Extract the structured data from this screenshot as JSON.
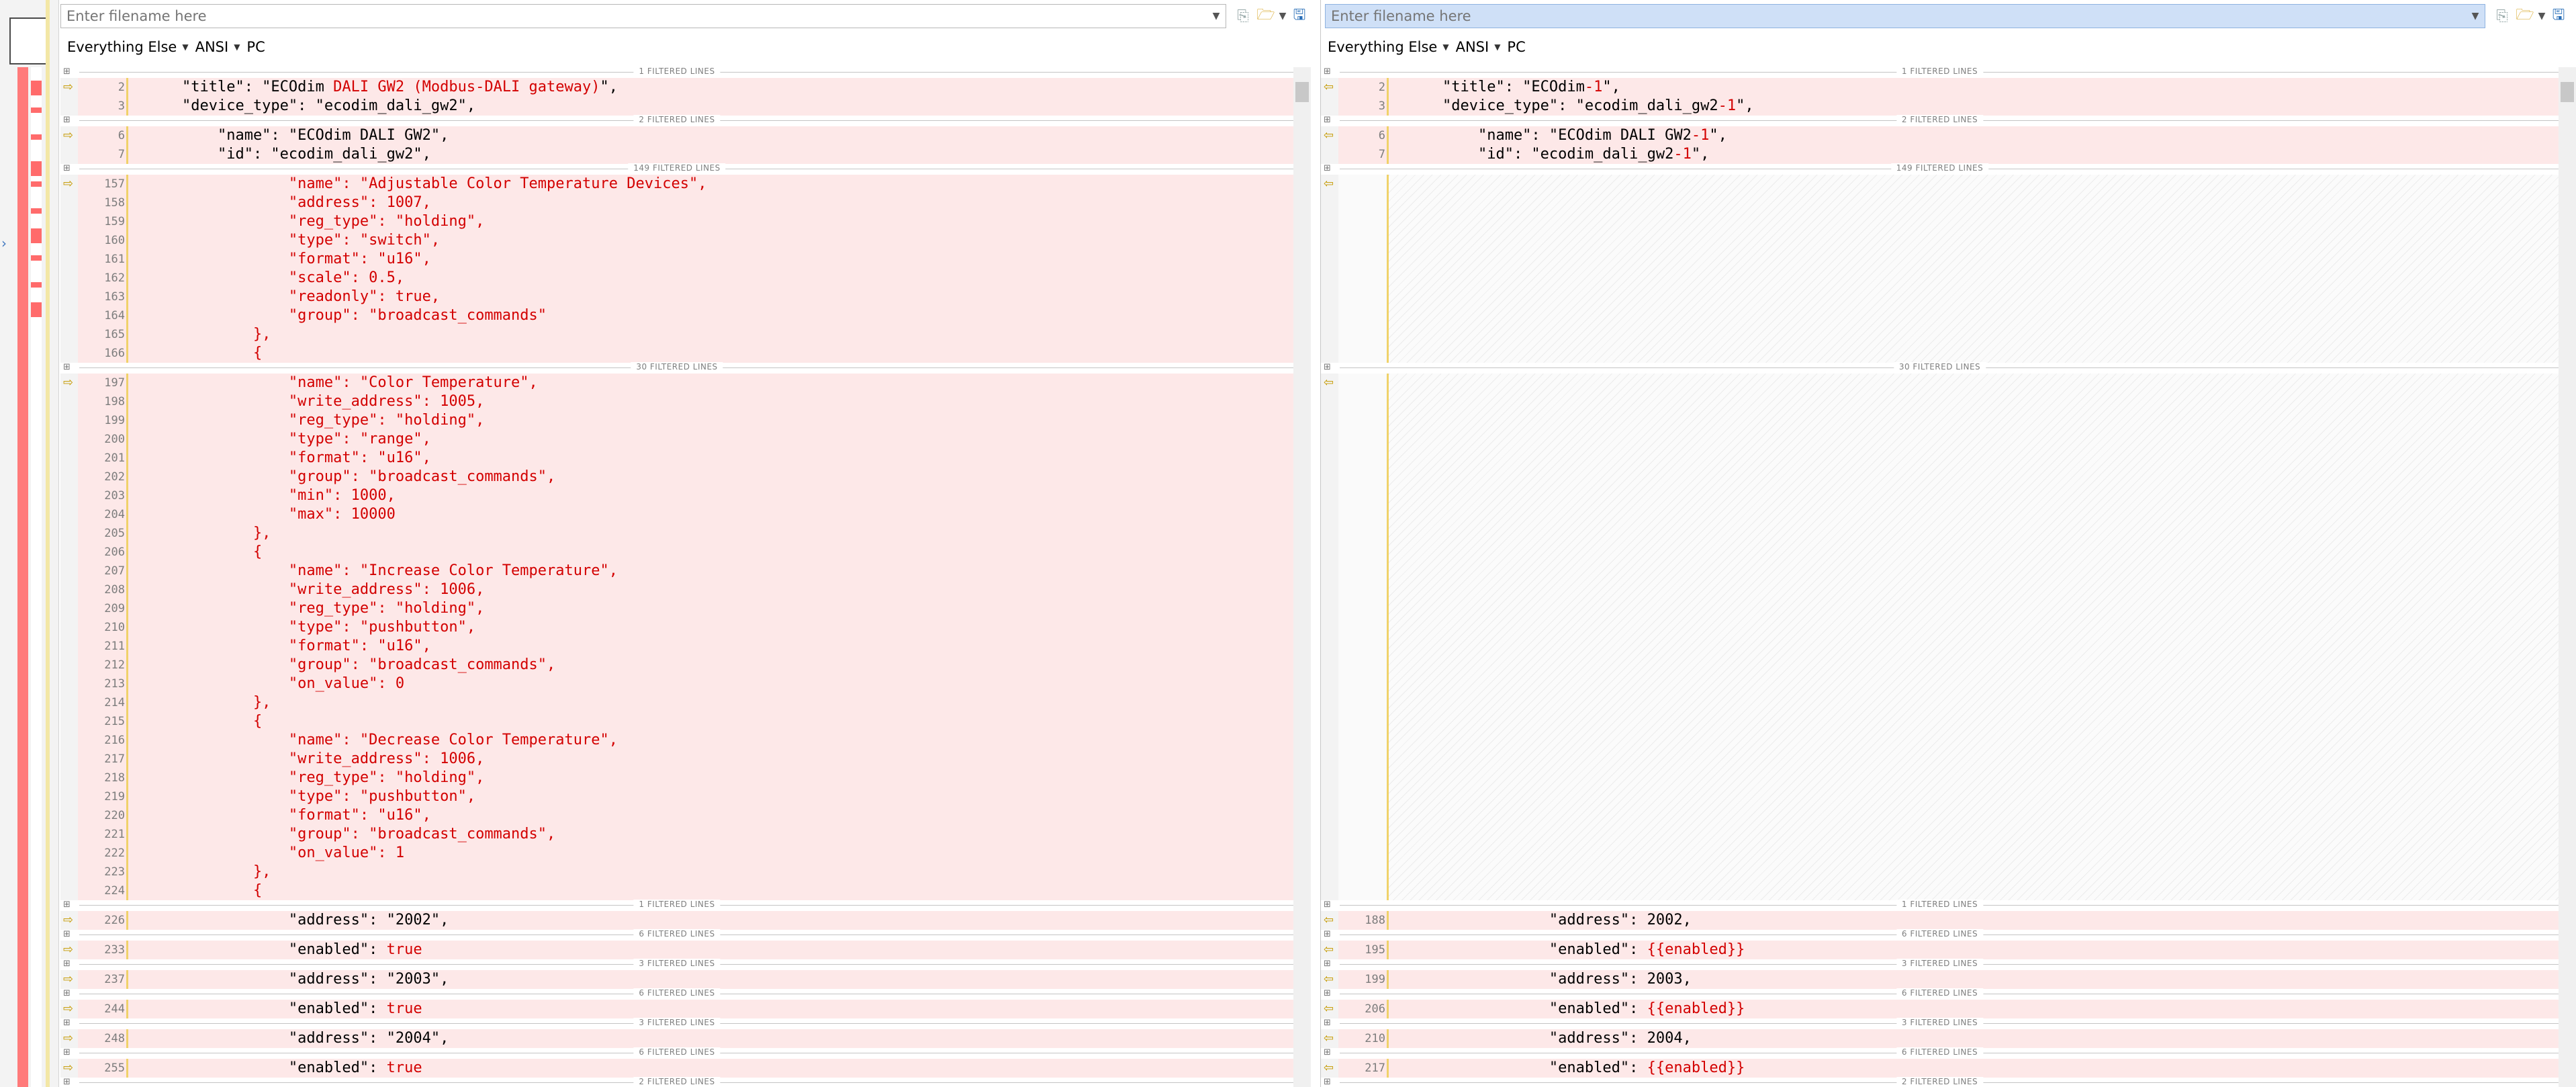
{
  "separator_label_suffix": "FILTERED LINES",
  "left": {
    "path_placeholder": "Enter filename here",
    "mode": {
      "filter": "Everything Else",
      "encoding": "ANSI",
      "line_endings": "PC"
    },
    "blocks": [
      {
        "kind": "sep",
        "count": "1 FILTERED LINES"
      },
      {
        "kind": "line",
        "num": "2",
        "text": "    \"title\": \"ECOdim ",
        "red": "DALI GW2 (Modbus-DALI gateway)",
        "tail": "\",",
        "arrow": true
      },
      {
        "kind": "line",
        "num": "3",
        "text": "    \"device_type\": \"ecodim_dali_gw2\","
      },
      {
        "kind": "sep",
        "count": "2 FILTERED LINES"
      },
      {
        "kind": "line",
        "num": "6",
        "text": "        \"name\": \"ECOdim DALI GW2\",",
        "arrow": true
      },
      {
        "kind": "line",
        "num": "7",
        "text": "        \"id\": \"ecodim_dali_gw2\","
      },
      {
        "kind": "sep",
        "count": "149 FILTERED LINES"
      },
      {
        "kind": "rline",
        "num": "157",
        "text": "                \"name\": \"Adjustable Color Temperature Devices\",",
        "arrow": true
      },
      {
        "kind": "rline",
        "num": "158",
        "text": "                \"address\": 1007,"
      },
      {
        "kind": "rline",
        "num": "159",
        "text": "                \"reg_type\": \"holding\","
      },
      {
        "kind": "rline",
        "num": "160",
        "text": "                \"type\": \"switch\","
      },
      {
        "kind": "rline",
        "num": "161",
        "text": "                \"format\": \"u16\","
      },
      {
        "kind": "rline",
        "num": "162",
        "text": "                \"scale\": 0.5,"
      },
      {
        "kind": "rline",
        "num": "163",
        "text": "                \"readonly\": true,"
      },
      {
        "kind": "rline",
        "num": "164",
        "text": "                \"group\": \"broadcast_commands\""
      },
      {
        "kind": "rline",
        "num": "165",
        "text": "            },"
      },
      {
        "kind": "rline",
        "num": "166",
        "text": "            {"
      },
      {
        "kind": "sep",
        "count": "30 FILTERED LINES"
      },
      {
        "kind": "rline",
        "num": "197",
        "text": "                \"name\": \"Color Temperature\",",
        "arrow": true
      },
      {
        "kind": "rline",
        "num": "198",
        "text": "                \"write_address\": 1005,"
      },
      {
        "kind": "rline",
        "num": "199",
        "text": "                \"reg_type\": \"holding\","
      },
      {
        "kind": "rline",
        "num": "200",
        "text": "                \"type\": \"range\","
      },
      {
        "kind": "rline",
        "num": "201",
        "text": "                \"format\": \"u16\","
      },
      {
        "kind": "rline",
        "num": "202",
        "text": "                \"group\": \"broadcast_commands\","
      },
      {
        "kind": "rline",
        "num": "203",
        "text": "                \"min\": 1000,"
      },
      {
        "kind": "rline",
        "num": "204",
        "text": "                \"max\": 10000"
      },
      {
        "kind": "rline",
        "num": "205",
        "text": "            },"
      },
      {
        "kind": "rline",
        "num": "206",
        "text": "            {"
      },
      {
        "kind": "rline",
        "num": "207",
        "text": "                \"name\": \"Increase Color Temperature\","
      },
      {
        "kind": "rline",
        "num": "208",
        "text": "                \"write_address\": 1006,"
      },
      {
        "kind": "rline",
        "num": "209",
        "text": "                \"reg_type\": \"holding\","
      },
      {
        "kind": "rline",
        "num": "210",
        "text": "                \"type\": \"pushbutton\","
      },
      {
        "kind": "rline",
        "num": "211",
        "text": "                \"format\": \"u16\","
      },
      {
        "kind": "rline",
        "num": "212",
        "text": "                \"group\": \"broadcast_commands\","
      },
      {
        "kind": "rline",
        "num": "213",
        "text": "                \"on_value\": 0"
      },
      {
        "kind": "rline",
        "num": "214",
        "text": "            },"
      },
      {
        "kind": "rline",
        "num": "215",
        "text": "            {"
      },
      {
        "kind": "rline",
        "num": "216",
        "text": "                \"name\": \"Decrease Color Temperature\","
      },
      {
        "kind": "rline",
        "num": "217",
        "text": "                \"write_address\": 1006,"
      },
      {
        "kind": "rline",
        "num": "218",
        "text": "                \"reg_type\": \"holding\","
      },
      {
        "kind": "rline",
        "num": "219",
        "text": "                \"type\": \"pushbutton\","
      },
      {
        "kind": "rline",
        "num": "220",
        "text": "                \"format\": \"u16\","
      },
      {
        "kind": "rline",
        "num": "221",
        "text": "                \"group\": \"broadcast_commands\","
      },
      {
        "kind": "rline",
        "num": "222",
        "text": "                \"on_value\": 1"
      },
      {
        "kind": "rline",
        "num": "223",
        "text": "            },"
      },
      {
        "kind": "rline",
        "num": "224",
        "text": "            {"
      },
      {
        "kind": "sep",
        "count": "1 FILTERED LINES"
      },
      {
        "kind": "line",
        "num": "226",
        "text": "                \"address\": \"2002\",",
        "arrow": true
      },
      {
        "kind": "sep",
        "count": "6 FILTERED LINES"
      },
      {
        "kind": "line",
        "num": "233",
        "text": "                \"enabled\": ",
        "red": "true",
        "tail": "",
        "arrow": true
      },
      {
        "kind": "sep",
        "count": "3 FILTERED LINES"
      },
      {
        "kind": "line",
        "num": "237",
        "text": "                \"address\": \"2003\",",
        "arrow": true
      },
      {
        "kind": "sep",
        "count": "6 FILTERED LINES"
      },
      {
        "kind": "line",
        "num": "244",
        "text": "                \"enabled\": ",
        "red": "true",
        "tail": "",
        "arrow": true
      },
      {
        "kind": "sep",
        "count": "3 FILTERED LINES"
      },
      {
        "kind": "line",
        "num": "248",
        "text": "                \"address\": \"2004\",",
        "arrow": true
      },
      {
        "kind": "sep",
        "count": "6 FILTERED LINES"
      },
      {
        "kind": "line",
        "num": "255",
        "text": "                \"enabled\": ",
        "red": "true",
        "tail": "",
        "arrow": true
      },
      {
        "kind": "sep",
        "count": "2 FILTERED LINES"
      }
    ]
  },
  "right": {
    "path_placeholder": "Enter filename here",
    "mode": {
      "filter": "Everything Else",
      "encoding": "ANSI",
      "line_endings": "PC"
    },
    "blocks": [
      {
        "kind": "sep",
        "count": "1 FILTERED LINES"
      },
      {
        "kind": "line",
        "num": "2",
        "text": "    \"title\": \"ECOdim",
        "red": "-1",
        "tail": "\",",
        "arrow": true
      },
      {
        "kind": "line",
        "num": "3",
        "text": "    \"device_type\": \"ecodim_dali_gw2",
        "red": "-1",
        "tail": "\","
      },
      {
        "kind": "sep",
        "count": "2 FILTERED LINES"
      },
      {
        "kind": "line",
        "num": "6",
        "text": "        \"name\": \"ECOdim DALI GW2",
        "red": "-1",
        "tail": "\",",
        "arrow": true
      },
      {
        "kind": "line",
        "num": "7",
        "text": "        \"id\": \"ecodim_dali_gw2",
        "red": "-1",
        "tail": "\","
      },
      {
        "kind": "sep",
        "count": "149 FILTERED LINES"
      },
      {
        "kind": "placeholder",
        "rows": 10
      },
      {
        "kind": "sep",
        "count": "30 FILTERED LINES"
      },
      {
        "kind": "placeholder",
        "rows": 28
      },
      {
        "kind": "sep",
        "count": "1 FILTERED LINES"
      },
      {
        "kind": "line",
        "num": "188",
        "text": "                \"address\": 2002,",
        "arrow": true
      },
      {
        "kind": "sep",
        "count": "6 FILTERED LINES"
      },
      {
        "kind": "line",
        "num": "195",
        "text": "                \"enabled\": ",
        "red": "{{enabled}}",
        "tail": "",
        "arrow": true
      },
      {
        "kind": "sep",
        "count": "3 FILTERED LINES"
      },
      {
        "kind": "line",
        "num": "199",
        "text": "                \"address\": 2003,",
        "arrow": true
      },
      {
        "kind": "sep",
        "count": "6 FILTERED LINES"
      },
      {
        "kind": "line",
        "num": "206",
        "text": "                \"enabled\": ",
        "red": "{{enabled}}",
        "tail": "",
        "arrow": true
      },
      {
        "kind": "sep",
        "count": "3 FILTERED LINES"
      },
      {
        "kind": "line",
        "num": "210",
        "text": "                \"address\": 2004,",
        "arrow": true
      },
      {
        "kind": "sep",
        "count": "6 FILTERED LINES"
      },
      {
        "kind": "line",
        "num": "217",
        "text": "                \"enabled\": ",
        "red": "{{enabled}}",
        "tail": "",
        "arrow": true
      },
      {
        "kind": "sep",
        "count": "2 FILTERED LINES"
      }
    ]
  },
  "colors": {
    "diff_bg": "#fde8e8",
    "diff_text": "#d30000",
    "arrow": "#c59a00",
    "overview_marker": "#ff6b6b"
  },
  "icons": {
    "copy": "copy-icon",
    "open": "folder-open-icon",
    "save": "save-icon",
    "diff_arrow": "arrow-icon"
  }
}
